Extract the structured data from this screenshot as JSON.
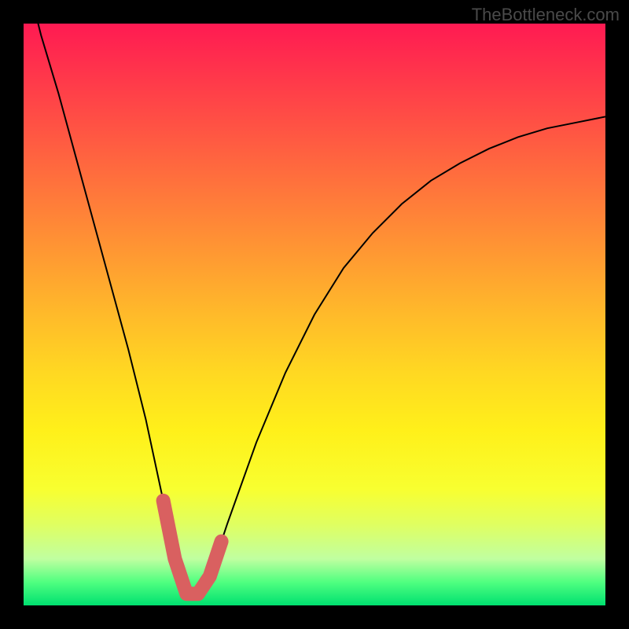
{
  "watermark": "TheBottleneck.com",
  "chart_data": {
    "type": "line",
    "title": "",
    "xlabel": "",
    "ylabel": "",
    "xlim": [
      0,
      100
    ],
    "ylim": [
      0,
      100
    ],
    "x": [
      0,
      3,
      6,
      9,
      12,
      15,
      18,
      21,
      24,
      26,
      28,
      30,
      32,
      35,
      40,
      45,
      50,
      55,
      60,
      65,
      70,
      75,
      80,
      85,
      90,
      95,
      100
    ],
    "values": [
      110,
      98,
      88,
      77,
      66,
      55,
      44,
      32,
      18,
      8,
      2,
      2,
      5,
      14,
      28,
      40,
      50,
      58,
      64,
      69,
      73,
      76,
      78.5,
      80.5,
      82,
      83,
      84
    ],
    "annotations": [
      {
        "type": "curve_segment",
        "description": "red U-shaped overlay near minimum",
        "x_range": [
          24,
          34
        ],
        "color": "#d96060",
        "stroke_width": 18
      }
    ]
  }
}
